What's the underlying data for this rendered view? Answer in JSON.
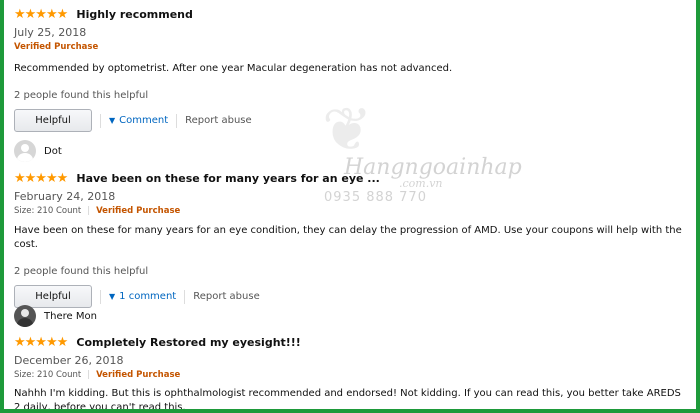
{
  "reviews": [
    {
      "stars": "★★★★★",
      "title": "Highly recommend",
      "date": "July 25, 2018",
      "verified": "Verified Purchase",
      "body": "Recommended by optometrist. After one year Macular degeneration has not advanced.",
      "helpful_count": "2 people found this helpful",
      "helpful_label": "Helpful",
      "comment_label": "Comment",
      "abuse_label": "Report abuse"
    },
    {
      "reviewer": "Dot",
      "stars": "★★★★★",
      "title": "Have been on these for many years for an eye ...",
      "date": "February 24, 2018",
      "size": "Size: 210 Count",
      "verified": "Verified Purchase",
      "body": "Have been on these for many years for an eye condition, they can delay the progression of AMD. Use your coupons will help with the cost.",
      "helpful_count": "2 people found this helpful",
      "helpful_label": "Helpful",
      "comment_label": "1 comment",
      "abuse_label": "Report abuse"
    },
    {
      "reviewer": "There Mon",
      "stars": "★★★★★",
      "title": "Completely Restored my eyesight!!!",
      "date": "December 26, 2018",
      "size": "Size: 210 Count",
      "verified": "Verified Purchase",
      "body": "Nahhh I'm kidding. But this is ophthalmologist recommended and endorsed! Not kidding. If you can read this, you better take AREDS 2 daily, before you can't read this."
    }
  ],
  "watermark": {
    "main": "Hangngoainhap",
    "sub": ".com.vn",
    "phone": "0935 888 770"
  },
  "colors": {
    "border": "#1e9a3a",
    "star": "#ff9900",
    "verified": "#c45500",
    "link": "#0066c0"
  }
}
